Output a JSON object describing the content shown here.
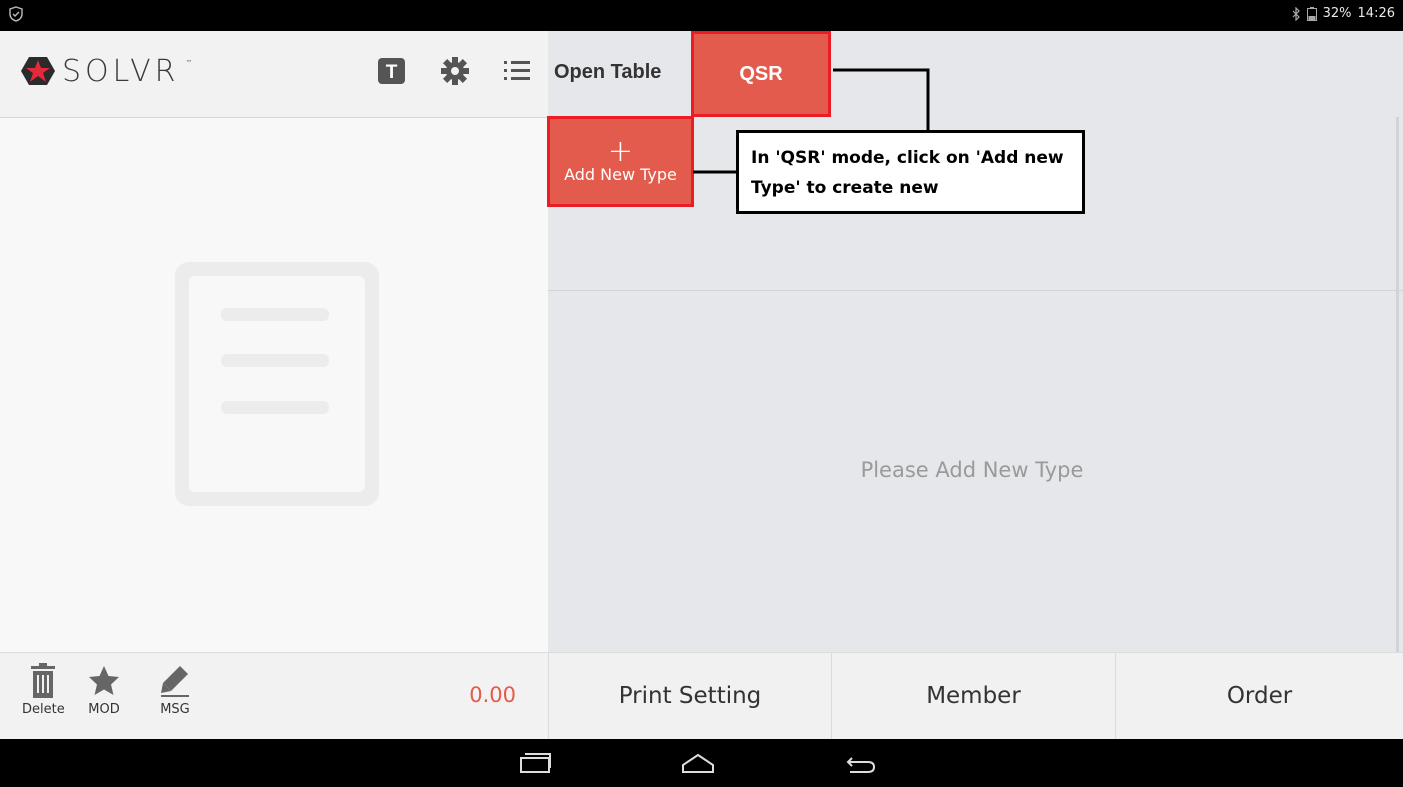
{
  "status_bar": {
    "battery": "32%",
    "time": "14:26"
  },
  "brand": {
    "name": "SOLVR",
    "tm": "™",
    "accent": "#e35b4c"
  },
  "header": {
    "icons": [
      "t-icon",
      "gear-icon",
      "list-icon"
    ],
    "t_label": "T"
  },
  "tabs": [
    {
      "label": "Open Table",
      "selected": false
    },
    {
      "label": "QSR",
      "selected": true
    }
  ],
  "type_bar": {
    "add_button_label": "Add New Type",
    "add_button_glyph": "+"
  },
  "items_area": {
    "empty_message": "Please Add New Type"
  },
  "order_tools": [
    {
      "label": "Delete",
      "icon": "trash-icon"
    },
    {
      "label": "MOD",
      "icon": "star-icon"
    },
    {
      "label": "MSG",
      "icon": "pencil-icon"
    }
  ],
  "order_total": "0.00",
  "footer_buttons": [
    {
      "label": "Print Setting"
    },
    {
      "label": "Member"
    },
    {
      "label": "Order"
    }
  ],
  "nav": [
    "recent-apps-icon",
    "home-icon",
    "back-icon"
  ],
  "annotation": {
    "text": "In 'QSR' mode, click on 'Add new Type' to create new"
  }
}
